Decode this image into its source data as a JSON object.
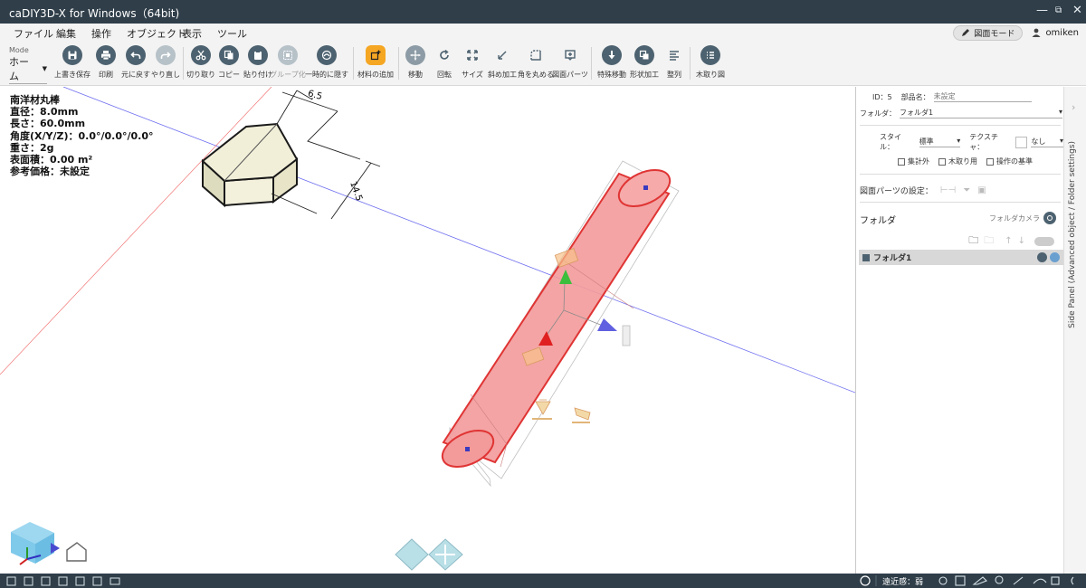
{
  "window": {
    "title": "caDIY3D-X for Windows（64bit)"
  },
  "menu": {
    "items": [
      "ファイル",
      "編集",
      "操作",
      "オブジェクト",
      "表示",
      "ツール"
    ]
  },
  "mode_button": {
    "label": "図面モード"
  },
  "user": {
    "name": "omiken"
  },
  "toolbar": {
    "mode_label": "Mode",
    "mode_value": "ホーム",
    "buttons": [
      "上書き保存",
      "印刷",
      "元に戻す",
      "やり直し",
      "切り取り",
      "コピー",
      "貼り付け",
      "グループ化",
      "一時的に隠す",
      "材料の追加",
      "移動",
      "回転",
      "サイズ",
      "斜め加工",
      "角を丸める",
      "図面パーツ",
      "特殊移動",
      "形状加工",
      "整列",
      "木取り図"
    ]
  },
  "info": {
    "name": "南洋材丸棒",
    "diameter": "直径：8.0mm",
    "length": "長さ：60.0mm",
    "angle": "角度(X/Y/Z)：0.0°/0.0°/0.0°",
    "weight": "重さ：2g",
    "area": "表面積：0.00 m²",
    "price": "参考価格：未設定"
  },
  "dimensions": {
    "d1": "6.5",
    "d2": "14.5"
  },
  "panel": {
    "id": "ID：5",
    "part_name_label": "部品名：",
    "part_name_placeholder": "未設定",
    "folder_label": "フォルダ：",
    "folder_value": "フォルダ1",
    "style_label": "スタイル：",
    "style_value": "標準",
    "texture_label": "テクスチャ：",
    "texture_value": "なし",
    "check1": "集計外",
    "check2": "木取り用",
    "check3": "操作の基準",
    "drawing_parts_label": "図面パーツの設定：",
    "folder_section": "フォルダ",
    "folder_camera": "フォルダカメラ",
    "folder_item": "フォルダ1"
  },
  "sidetab": {
    "label": "Side Panel (Advanced object / Folder settings)"
  },
  "status": {
    "near_label": "遠近感：弱"
  },
  "colors": {
    "titlebar": "#2f3e49",
    "accent": "#f5a623",
    "icon": "#4d6270",
    "selection": "#f08080"
  }
}
